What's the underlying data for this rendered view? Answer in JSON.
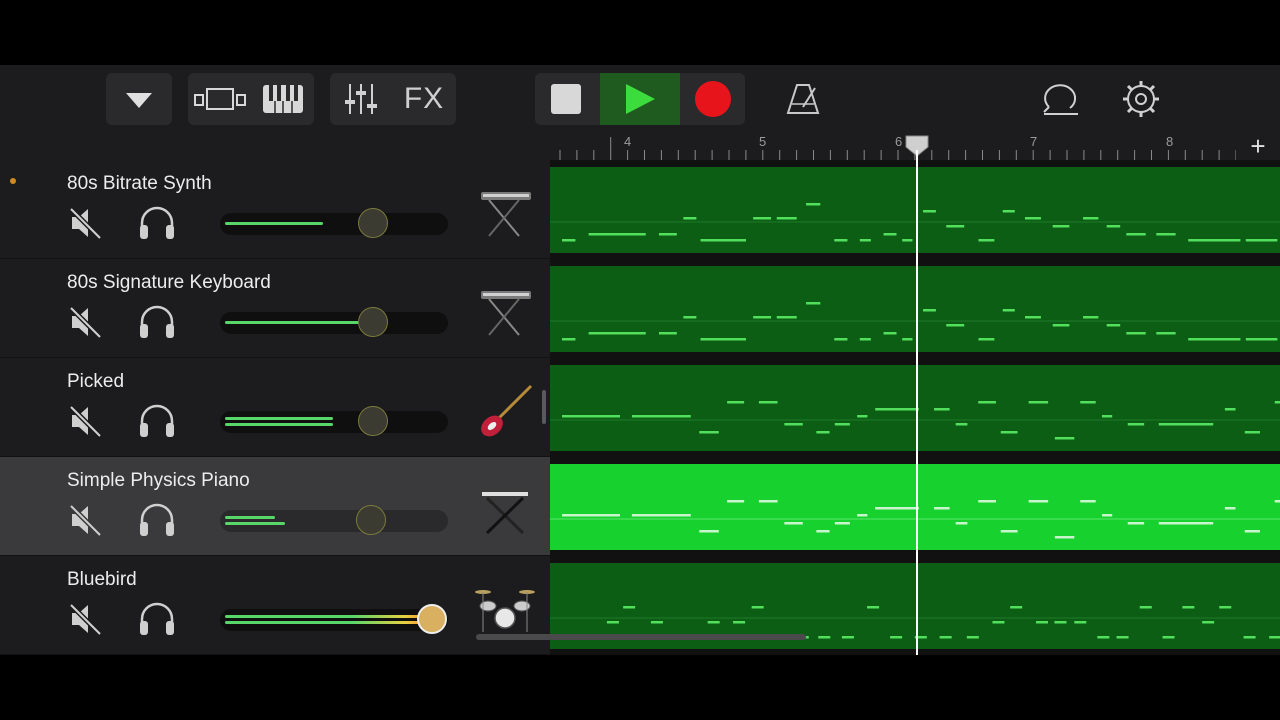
{
  "toolbar": {
    "view_menu_icon": "triangle-down-icon",
    "tracks_view_icon": "tracks-view-icon",
    "keyboard_icon": "piano-keys-icon",
    "mixer_icon": "mixer-sliders-icon",
    "fx_label": "FX",
    "stop_icon": "stop-icon",
    "play_icon": "play-icon",
    "record_icon": "record-icon",
    "metronome_icon": "metronome-icon",
    "loop_icon": "loop-browser-icon",
    "settings_icon": "gear-icon",
    "colors": {
      "play_active_bg": "#1f5a1f",
      "play_green": "#3ddc3d",
      "record_red": "#e8141b"
    }
  },
  "ruler": {
    "bars": [
      "4",
      "5",
      "6",
      "7",
      "8"
    ],
    "add_label": "+"
  },
  "tracks": [
    {
      "name": "80s Bitrate Synth",
      "instrument_icon": "keyboard-synth-icon",
      "volume": 0.68,
      "meter": [
        0.44
      ],
      "selected": false,
      "has_dot": true
    },
    {
      "name": "80s Signature Keyboard",
      "instrument_icon": "keyboard-synth-icon",
      "volume": 0.68,
      "meter": [
        0.72
      ],
      "selected": false,
      "has_dot": false
    },
    {
      "name": "Picked",
      "instrument_icon": "bass-guitar-icon",
      "volume": 0.68,
      "meter": [
        0.48,
        0.48
      ],
      "selected": false,
      "has_dot": false
    },
    {
      "name": "Simple Physics Piano",
      "instrument_icon": "keyboard-stand-icon",
      "volume": 0.68,
      "meter": [
        0.22,
        0.26
      ],
      "selected": true,
      "has_dot": false
    },
    {
      "name": "Bluebird",
      "instrument_icon": "drum-kit-icon",
      "volume": 0.93,
      "meter": [
        0.93,
        0.93
      ],
      "selected": false,
      "has_dot": false
    }
  ],
  "region_colors": {
    "normal": "#0b5e14",
    "selected": "#17d12e",
    "note": "#52e05c",
    "note_selected": "#c8f5cc"
  }
}
